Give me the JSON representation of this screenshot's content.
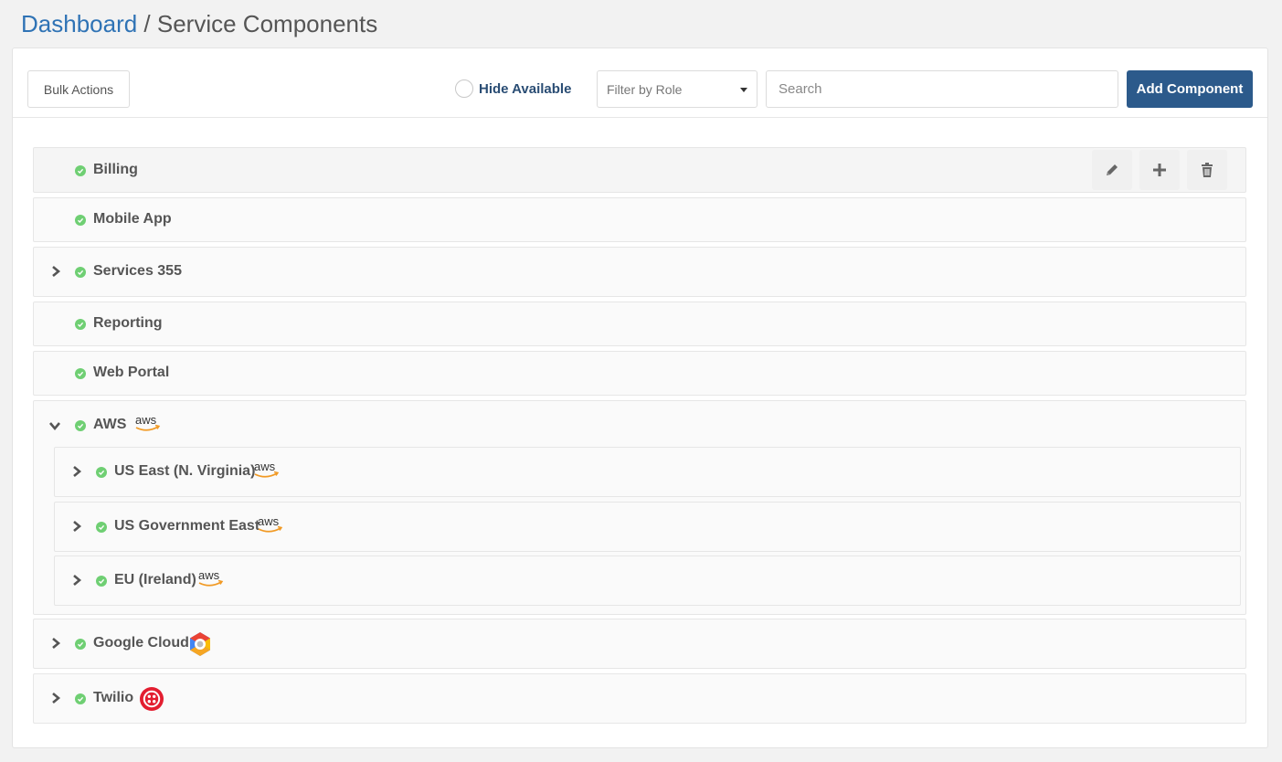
{
  "breadcrumb": {
    "link": "Dashboard",
    "separator": " / ",
    "current": "Service Components"
  },
  "toolbar": {
    "bulk_actions": "Bulk Actions",
    "hide_available": "Hide Available",
    "filter_role": "Filter by Role",
    "search_placeholder": "Search",
    "add_component": "Add Component"
  },
  "components": [
    {
      "name": "Billing"
    },
    {
      "name": "Mobile App"
    },
    {
      "name": "Services 355"
    },
    {
      "name": "Reporting"
    },
    {
      "name": "Web Portal"
    },
    {
      "name": "AWS",
      "logo_text": "aws",
      "children": [
        {
          "name": "US East (N. Virginia)",
          "logo_text": "aws"
        },
        {
          "name": "US Government East",
          "logo_text": "aws"
        },
        {
          "name": "EU (Ireland)",
          "logo_text": "aws"
        }
      ]
    },
    {
      "name": "Google Cloud"
    },
    {
      "name": "Twilio"
    }
  ],
  "colors": {
    "accent": "#2c5a8b",
    "link": "#2f73b5",
    "status_ok": "#6fcf73",
    "aws_orange": "#f19a25",
    "twilio_red": "#e31e30"
  }
}
